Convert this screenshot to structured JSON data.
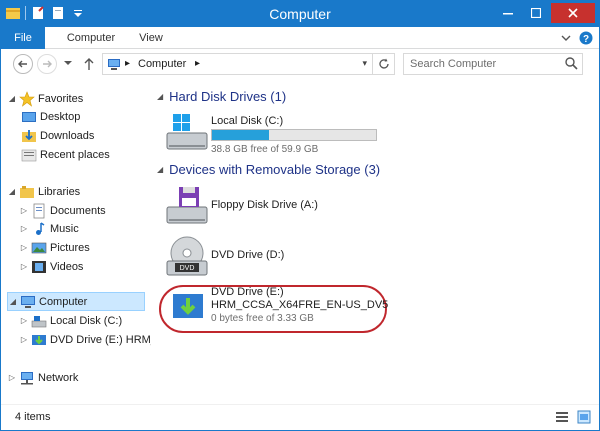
{
  "window": {
    "title": "Computer"
  },
  "ribbon": {
    "tabs": [
      "File",
      "Computer",
      "View"
    ]
  },
  "address": {
    "crumb": "Computer"
  },
  "search": {
    "placeholder": "Search Computer"
  },
  "sidebar": {
    "items": [
      {
        "label": "Favorites",
        "icon": "star-icon"
      },
      {
        "label": "Desktop",
        "icon": "desktop-icon"
      },
      {
        "label": "Downloads",
        "icon": "downloads-icon"
      },
      {
        "label": "Recent places",
        "icon": "recent-places-icon"
      },
      {
        "label": "Libraries",
        "icon": "libraries-icon"
      },
      {
        "label": "Documents",
        "icon": "documents-icon"
      },
      {
        "label": "Music",
        "icon": "music-icon"
      },
      {
        "label": "Pictures",
        "icon": "pictures-icon"
      },
      {
        "label": "Videos",
        "icon": "videos-icon"
      },
      {
        "label": "Computer",
        "icon": "computer-icon"
      },
      {
        "label": "Local Disk (C:)",
        "icon": "local-disk-icon"
      },
      {
        "label": "DVD Drive (E:) HRM_",
        "icon": "dvd-drive-icon"
      },
      {
        "label": "Network",
        "icon": "network-icon"
      }
    ]
  },
  "main": {
    "groups": [
      {
        "header": "Hard Disk Drives (1)"
      },
      {
        "header": "Devices with Removable Storage (3)"
      }
    ],
    "drives": [
      {
        "name": "Local Disk (C:)",
        "free": "38.8 GB free of 59.9 GB",
        "used_fraction": 0.35
      },
      {
        "name": "Floppy Disk Drive (A:)"
      },
      {
        "name": "DVD Drive (D:)"
      },
      {
        "name": "DVD Drive (E:)",
        "volume": "HRM_CCSA_X64FRE_EN-US_DV5",
        "free": "0 bytes free of 3.33 GB"
      }
    ]
  },
  "status": {
    "count": "4 items"
  },
  "colors": {
    "accent": "#1979ca",
    "selection": "#cce8ff",
    "progress": "#26a0da",
    "highlight": "#c0272d"
  }
}
